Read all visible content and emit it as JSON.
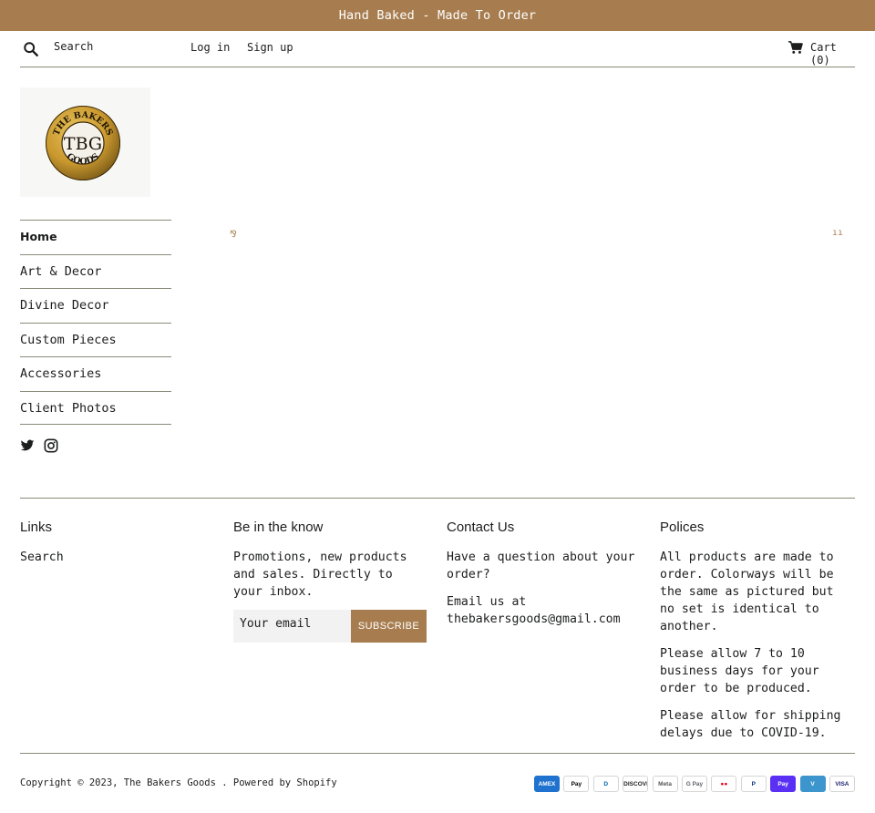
{
  "announcement": "Hand Baked - Made To Order",
  "header": {
    "search_label": "Search",
    "login": "Log in",
    "signup": "Sign up",
    "cart": "Cart (0)"
  },
  "logo": {
    "top_text": "THE BAKERS",
    "monogram": "TBG",
    "bottom_text": "GOODS"
  },
  "nav": {
    "items": [
      {
        "label": "Home"
      },
      {
        "label": "Art & Decor"
      },
      {
        "label": "Divine Decor"
      },
      {
        "label": "Custom Pieces"
      },
      {
        "label": "Accessories"
      },
      {
        "label": "Client Photos"
      }
    ]
  },
  "slideshow": {
    "left_control": "⅋",
    "right_control": "ıı"
  },
  "footer": {
    "links": {
      "title": "Links",
      "search": "Search"
    },
    "newsletter": {
      "title": "Be in the know",
      "text": "Promotions, new products and sales. Directly to your inbox.",
      "placeholder": "Your email",
      "button": "SUBSCRIBE"
    },
    "contact": {
      "title": "Contact Us",
      "text1": "Have a question about your order?",
      "text2": "Email us at thebakersgoods@gmail.com"
    },
    "policies": {
      "title": "Polices",
      "text1": "All products are made to order.  Colorways will be the same as pictured but no set is identical to another.",
      "text2": "Please allow 7 to 10 business days for your order to be produced.",
      "text3": "Please allow for shipping delays due to COVID-19."
    },
    "copyright": "Copyright © 2023, The Bakers Goods . Powered by Shopify"
  },
  "payments": [
    {
      "label": "AMEX",
      "bg": "#1f72cd",
      "fg": "#ffffff"
    },
    {
      "label": "Pay",
      "bg": "#ffffff",
      "fg": "#000000"
    },
    {
      "label": "D",
      "bg": "#ffffff",
      "fg": "#0165ac"
    },
    {
      "label": "DISCOVER",
      "bg": "#ffffff",
      "fg": "#231f20"
    },
    {
      "label": "Meta",
      "bg": "#ffffff",
      "fg": "#555555"
    },
    {
      "label": "G Pay",
      "bg": "#ffffff",
      "fg": "#5f6368"
    },
    {
      "label": "●●",
      "bg": "#ffffff",
      "fg": "#eb001b"
    },
    {
      "label": "P",
      "bg": "#ffffff",
      "fg": "#003087"
    },
    {
      "label": "Pay",
      "bg": "#5a31f4",
      "fg": "#ffffff"
    },
    {
      "label": "V",
      "bg": "#3d95ce",
      "fg": "#ffffff"
    },
    {
      "label": "VISA",
      "bg": "#ffffff",
      "fg": "#1a1f71"
    }
  ],
  "colors": {
    "accent": "#a77d4f",
    "text": "#1c1d1d",
    "rule": "#8a8a7a"
  }
}
